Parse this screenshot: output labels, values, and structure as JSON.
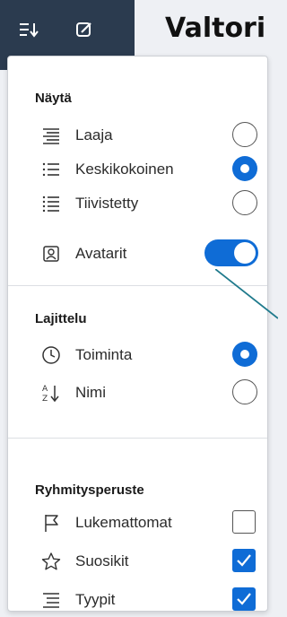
{
  "topbar": {
    "title": "Valtori",
    "sort_button_icon": "sort-list-icon",
    "compose_button_icon": "compose-icon"
  },
  "panel": {
    "show": {
      "title": "Näytä",
      "items": [
        {
          "label": "Laaja",
          "icon": "list-wide-icon",
          "selected": false
        },
        {
          "label": "Keskikokoinen",
          "icon": "list-medium-icon",
          "selected": true
        },
        {
          "label": "Tiivistetty",
          "icon": "list-compact-icon",
          "selected": false
        }
      ],
      "avatars": {
        "label": "Avatarit",
        "icon": "avatar-icon",
        "enabled": true
      }
    },
    "sort": {
      "title": "Lajittelu",
      "items": [
        {
          "label": "Toiminta",
          "icon": "clock-icon",
          "selected": true
        },
        {
          "label": "Nimi",
          "icon": "sort-alpha-icon",
          "selected": false
        }
      ]
    },
    "group": {
      "title": "Ryhmitysperuste",
      "items": [
        {
          "label": "Lukemattomat",
          "icon": "flag-icon",
          "checked": false
        },
        {
          "label": "Suosikit",
          "icon": "star-icon",
          "checked": true
        },
        {
          "label": "Tyypit",
          "icon": "list-types-icon",
          "checked": true
        }
      ]
    }
  },
  "colors": {
    "accent": "#0f6cd6",
    "topbar_dark": "#2b3b4f",
    "pointer_line": "#1f7a8c"
  }
}
